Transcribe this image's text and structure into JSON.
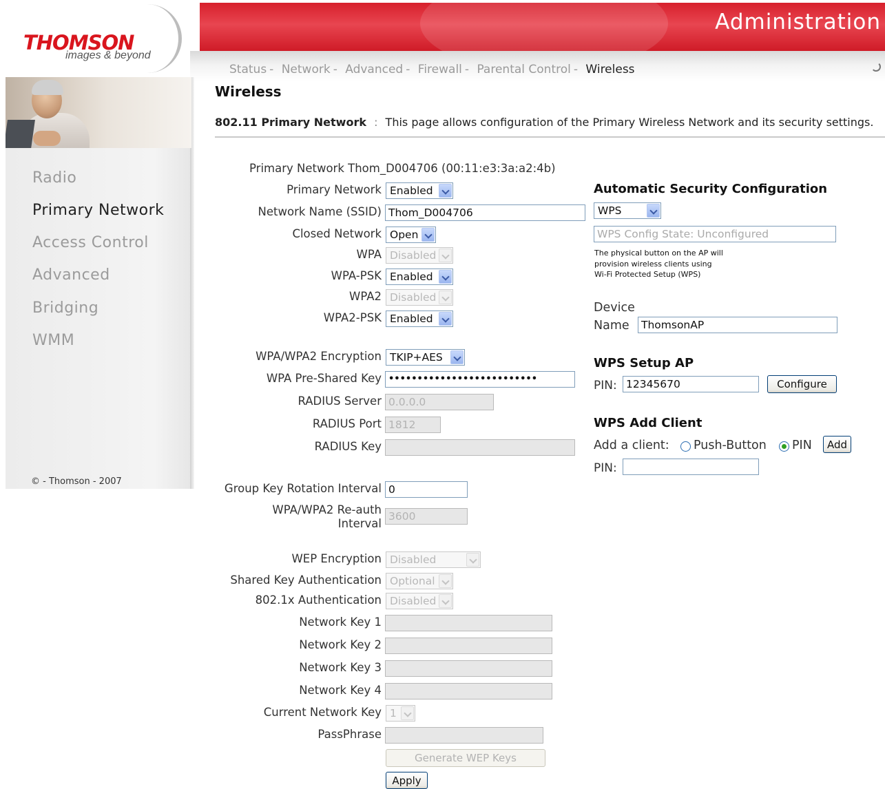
{
  "brand": {
    "name": "THOMSON",
    "tagline": "images & beyond"
  },
  "header": {
    "title": "Administration"
  },
  "nav": {
    "items": [
      {
        "label": "Status"
      },
      {
        "label": "Network"
      },
      {
        "label": "Advanced"
      },
      {
        "label": "Firewall"
      },
      {
        "label": "Parental Control"
      },
      {
        "label": "Wireless"
      }
    ],
    "separator": "-",
    "active": "Wireless"
  },
  "sidebar": {
    "items": [
      {
        "label": "Radio"
      },
      {
        "label": "Primary Network"
      },
      {
        "label": "Access Control"
      },
      {
        "label": "Advanced"
      },
      {
        "label": "Bridging"
      },
      {
        "label": "WMM"
      }
    ],
    "active": "Primary Network",
    "copyright": "© - Thomson - 2007"
  },
  "page": {
    "title": "Wireless",
    "description_title": "802.11 Primary Network",
    "description_sep": ":",
    "description": "This page allows configuration of the Primary Wireless Network and its security settings."
  },
  "form": {
    "network_info": "Primary Network Thom_D004706 (00:11:e3:3a:a2:4b)",
    "primary_network": {
      "label": "Primary Network",
      "value": "Enabled"
    },
    "ssid": {
      "label": "Network Name (SSID)",
      "value": "Thom_D004706"
    },
    "closed_network": {
      "label": "Closed Network",
      "value": "Open"
    },
    "wpa": {
      "label": "WPA",
      "value": "Disabled"
    },
    "wpa_psk": {
      "label": "WPA-PSK",
      "value": "Enabled"
    },
    "wpa2": {
      "label": "WPA2",
      "value": "Disabled"
    },
    "wpa2_psk": {
      "label": "WPA2-PSK",
      "value": "Enabled"
    },
    "encryption": {
      "label": "WPA/WPA2 Encryption",
      "value": "TKIP+AES"
    },
    "psk": {
      "label": "WPA Pre-Shared Key",
      "value": "••••••••••••••••••••••••••"
    },
    "radius_server": {
      "label": "RADIUS Server",
      "value": "0.0.0.0"
    },
    "radius_port": {
      "label": "RADIUS Port",
      "value": "1812"
    },
    "radius_key": {
      "label": "RADIUS Key",
      "value": ""
    },
    "group_key": {
      "label": "Group Key Rotation Interval",
      "value": "0"
    },
    "reauth": {
      "label_line1": "WPA/WPA2 Re-auth",
      "label_line2": "Interval",
      "value": "3600"
    },
    "wep_encryption": {
      "label": "WEP Encryption",
      "value": "Disabled"
    },
    "shared_key_auth": {
      "label": "Shared Key Authentication",
      "value": "Optional"
    },
    "dot1x_auth": {
      "label": "802.1x Authentication",
      "value": "Disabled"
    },
    "network_key_1": {
      "label": "Network Key 1",
      "value": ""
    },
    "network_key_2": {
      "label": "Network Key 2",
      "value": ""
    },
    "network_key_3": {
      "label": "Network Key 3",
      "value": ""
    },
    "network_key_4": {
      "label": "Network Key 4",
      "value": ""
    },
    "current_network_key": {
      "label": "Current Network Key",
      "value": "1"
    },
    "passphrase": {
      "label": "PassPhrase",
      "value": ""
    },
    "generate_wep": "Generate WEP Keys",
    "apply": "Apply"
  },
  "wps": {
    "auto_config_title": "Automatic Security Configuration",
    "mode": "WPS",
    "config_state": "WPS Config State: Unconfigured",
    "note_line1": "The physical button on the AP will",
    "note_line2": "provision wireless clients using",
    "note_line3": "Wi-Fi Protected Setup (WPS)",
    "device_label": "Device",
    "name_label": "Name",
    "device_name": "ThomsonAP",
    "setup_title": "WPS Setup AP",
    "pin_label": "PIN:",
    "ap_pin": "12345670",
    "configure": "Configure",
    "add_client_title": "WPS Add Client",
    "add_client_label": "Add a client:",
    "push_button": "Push-Button",
    "pin_option": "PIN",
    "selected_method": "PIN",
    "add": "Add",
    "client_pin_label": "PIN:",
    "client_pin": ""
  },
  "colors": {
    "brand_red": "#d7202c",
    "nav_inactive": "#9a9a9a",
    "radio_selected": "#2fa023"
  },
  "icons": {
    "spinner": "loading-spinner-icon",
    "select": "chevron-down-icon"
  }
}
